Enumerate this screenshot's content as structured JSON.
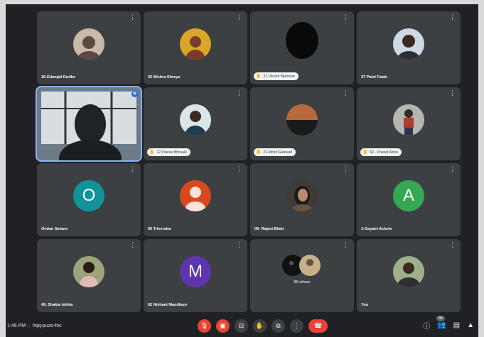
{
  "tiles": [
    {
      "name": "16.Gitanjali Dudhe",
      "style": "photo",
      "bg": "#c9b9a8",
      "fg": "#5a4a40"
    },
    {
      "name": "32 Mishra Shreya",
      "style": "photo",
      "bg": "#d9a62a",
      "fg": "#7a3c2a"
    },
    {
      "name": "31-Vikrant Bijamwar",
      "style": "pill-photo",
      "bg": "#0a0a0a",
      "fg": "#0a0a0a"
    },
    {
      "name": "37 Patel Falak",
      "style": "photo",
      "bg": "#cfd9e6",
      "fg": "#2d2d33"
    },
    {
      "name": "",
      "style": "camera"
    },
    {
      "name": "12 Pranav Bhosale",
      "style": "pill-photo",
      "bg": "#dde6e6",
      "fg": "#1f3d4a"
    },
    {
      "name": "21-Mohit Gaikwad",
      "style": "pill-photo",
      "bg": "#6d4a3b",
      "fg": "#c57c48"
    },
    {
      "name": "62 - Prasad Alone",
      "style": "pill-photo",
      "bg": "#b3b7b0",
      "fg": "#b23a2e"
    },
    {
      "name": "Omkar Sahare",
      "style": "letter",
      "letter": "O",
      "bg": "#12939a"
    },
    {
      "name": "06 Trivendra",
      "style": "person-icon",
      "bg": "#d8491f"
    },
    {
      "name": "09- Rajani Bhati",
      "style": "photo",
      "bg": "#3f3a36",
      "fg": "#6b5146"
    },
    {
      "name": "1-Gayatri Achole",
      "style": "letter",
      "letter": "A",
      "bg": "#34a853"
    },
    {
      "name": "49. Shakta Ishika",
      "style": "photo",
      "bg": "#9da37a",
      "fg": "#e3b9b4"
    },
    {
      "name": "62 Nishant Mandhare",
      "style": "letter",
      "letter": "M",
      "bg": "#5e35b1"
    },
    {
      "name": "85 others",
      "style": "others"
    },
    {
      "name": "You",
      "style": "photo",
      "bg": "#9eb08a",
      "fg": "#2f2f33"
    }
  ],
  "meeting": {
    "time": "1:46 PM",
    "code": "hqq-puzo-fnc"
  },
  "people_count": "88",
  "colors": {
    "end_call": "#ea4335",
    "tile_bg": "#3c4043",
    "screen_bg": "#202124"
  }
}
